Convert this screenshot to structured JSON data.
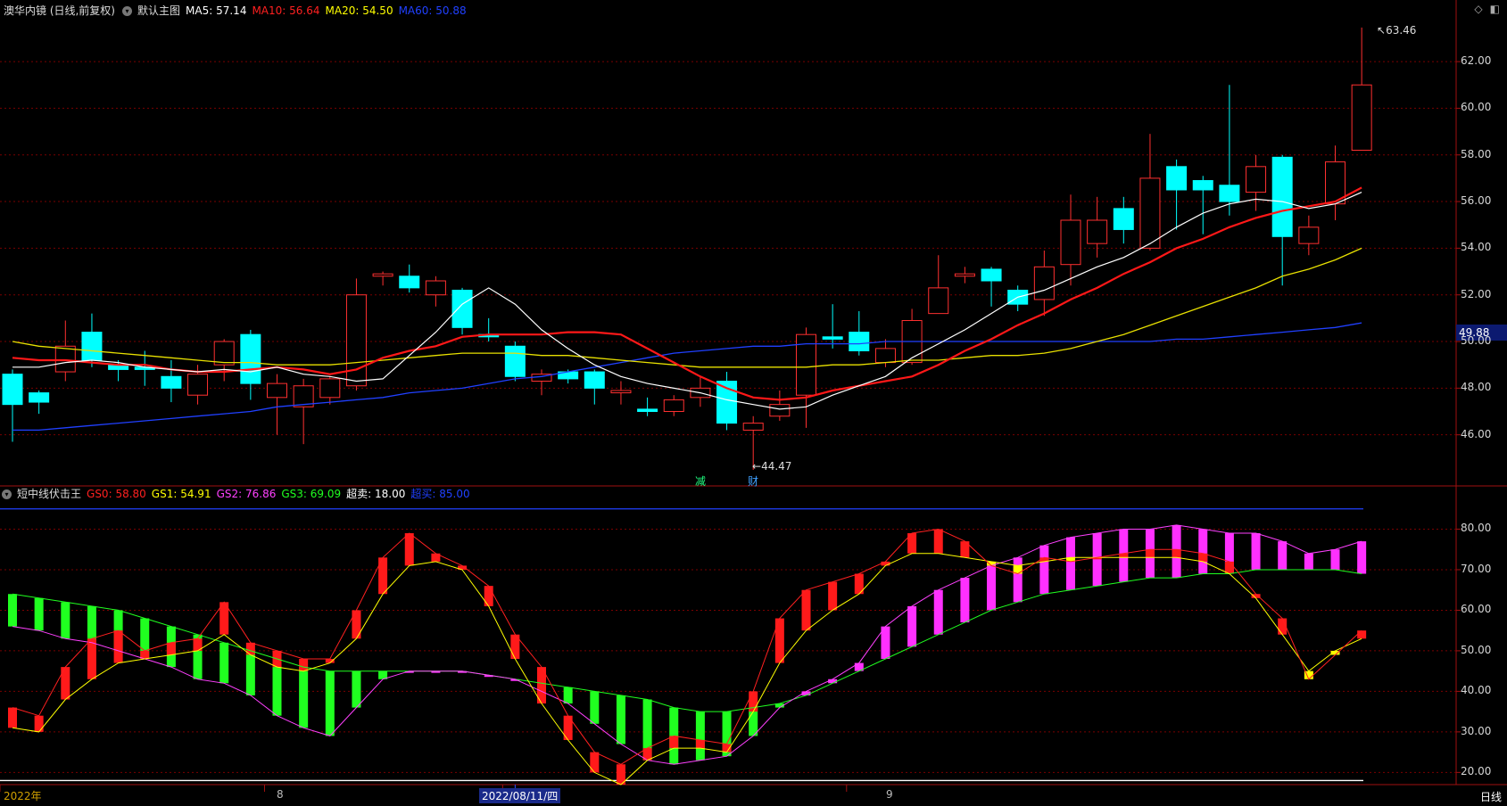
{
  "main": {
    "name": "澳华内镜 (日线,前复权)",
    "template": "默认主图",
    "ma": [
      {
        "label": "MA5:",
        "value": "57.14",
        "color": "#ffffff"
      },
      {
        "label": "MA10:",
        "value": "56.64",
        "color": "#ff2020"
      },
      {
        "label": "MA20:",
        "value": "54.50",
        "color": "#ffff00"
      },
      {
        "label": "MA60:",
        "value": "50.88",
        "color": "#2040ff"
      }
    ],
    "high_label": "63.46",
    "low_label": "44.47",
    "current_price_box": "49.88",
    "event_marks": [
      "减",
      "财"
    ],
    "ylim": [
      44,
      63.8
    ],
    "yticks": [
      "62.00",
      "60.00",
      "58.00",
      "56.00",
      "54.00",
      "52.00",
      "50.00",
      "48.00",
      "46.00"
    ]
  },
  "sub": {
    "name": "短中线伏击王",
    "indicators": [
      {
        "label": "GS0:",
        "value": "58.80",
        "color": "#ff2020"
      },
      {
        "label": "GS1:",
        "value": "54.91",
        "color": "#ffff00"
      },
      {
        "label": "GS2:",
        "value": "76.86",
        "color": "#ff40ff"
      },
      {
        "label": "GS3:",
        "value": "69.09",
        "color": "#20ff20"
      },
      {
        "label": "超卖:",
        "value": "18.00",
        "color": "#ffffff"
      },
      {
        "label": "超买:",
        "value": "85.00",
        "color": "#2040ff"
      }
    ],
    "ylim": [
      17,
      90
    ],
    "yticks": [
      "80.00",
      "70.00",
      "60.00",
      "50.00",
      "40.00",
      "30.00",
      "20.00"
    ]
  },
  "xaxis": {
    "labels": [
      "2022年",
      "8",
      "2022/08/11/四",
      "9"
    ],
    "period": "日线"
  },
  "chart_data": [
    {
      "type": "candlestick",
      "title": "澳华内镜 (日线,前复权)",
      "candles": [
        [
          48.6,
          47.3,
          45.7,
          48.8
        ],
        [
          47.8,
          47.4,
          46.9,
          47.9
        ],
        [
          48.7,
          49.8,
          48.3,
          50.9
        ],
        [
          50.4,
          49.2,
          48.9,
          51.2
        ],
        [
          49.0,
          48.8,
          48.3,
          49.2
        ],
        [
          48.9,
          48.8,
          48.1,
          49.6
        ],
        [
          48.5,
          48.0,
          47.4,
          49.2
        ],
        [
          47.7,
          48.6,
          47.3,
          49.0
        ],
        [
          49.0,
          50.0,
          48.3,
          50.1
        ],
        [
          50.3,
          48.2,
          47.5,
          50.5
        ],
        [
          47.6,
          48.2,
          46.0,
          48.6
        ],
        [
          47.2,
          48.1,
          45.6,
          48.4
        ],
        [
          47.6,
          48.4,
          47.3,
          48.5
        ],
        [
          48.1,
          52.0,
          47.9,
          52.7
        ],
        [
          52.8,
          52.9,
          52.4,
          53.0
        ],
        [
          52.8,
          52.3,
          52.1,
          53.3
        ],
        [
          52.0,
          52.6,
          51.5,
          52.8
        ],
        [
          52.2,
          50.6,
          50.3,
          52.3
        ],
        [
          50.3,
          50.2,
          50.0,
          51.0
        ],
        [
          49.8,
          48.5,
          48.3,
          50.0
        ],
        [
          48.3,
          48.6,
          47.7,
          48.8
        ],
        [
          48.7,
          48.4,
          48.2,
          48.8
        ],
        [
          48.7,
          48.0,
          47.3,
          48.8
        ],
        [
          47.8,
          47.9,
          47.3,
          48.3
        ],
        [
          47.1,
          47.0,
          46.8,
          47.6
        ],
        [
          47.0,
          47.5,
          46.8,
          47.7
        ],
        [
          47.6,
          48.0,
          47.2,
          48.5
        ],
        [
          48.3,
          46.5,
          46.2,
          48.7
        ],
        [
          46.2,
          46.5,
          44.5,
          46.8
        ],
        [
          46.8,
          47.3,
          46.6,
          47.9
        ],
        [
          47.7,
          50.3,
          46.3,
          50.6
        ],
        [
          50.2,
          50.1,
          49.7,
          51.6
        ],
        [
          50.4,
          49.6,
          49.4,
          51.3
        ],
        [
          49.1,
          49.7,
          48.9,
          50.1
        ],
        [
          49.1,
          50.9,
          49.0,
          51.4
        ],
        [
          51.2,
          52.3,
          51.2,
          53.7
        ],
        [
          52.8,
          52.9,
          52.5,
          53.2
        ],
        [
          53.1,
          52.6,
          51.5,
          53.2
        ],
        [
          52.2,
          51.6,
          51.3,
          52.4
        ],
        [
          51.8,
          53.2,
          51.1,
          53.9
        ],
        [
          53.3,
          55.2,
          52.4,
          56.3
        ],
        [
          54.2,
          55.2,
          53.6,
          56.2
        ],
        [
          55.7,
          54.8,
          54.2,
          56.2
        ],
        [
          54.0,
          57.0,
          53.9,
          58.9
        ],
        [
          57.5,
          56.5,
          54.8,
          57.8
        ],
        [
          56.9,
          56.5,
          54.6,
          57.1
        ],
        [
          56.7,
          56.0,
          55.4,
          61.0
        ],
        [
          56.4,
          57.5,
          55.6,
          58.0
        ],
        [
          57.9,
          54.5,
          52.4,
          58.0
        ],
        [
          54.2,
          54.9,
          53.7,
          55.4
        ],
        [
          55.9,
          57.7,
          55.2,
          58.4
        ],
        [
          58.2,
          61.0,
          58.2,
          63.46
        ]
      ],
      "ma5": [
        48.9,
        48.9,
        49.1,
        49.2,
        49.1,
        48.9,
        48.8,
        48.7,
        48.8,
        48.7,
        48.9,
        48.6,
        48.5,
        48.3,
        48.4,
        49.4,
        50.4,
        51.6,
        52.3,
        51.6,
        50.5,
        49.7,
        49.0,
        48.5,
        48.2,
        48.0,
        47.8,
        47.5,
        47.3,
        47.1,
        47.2,
        47.7,
        48.1,
        48.5,
        49.3,
        49.9,
        50.5,
        51.2,
        51.9,
        52.2,
        52.7,
        53.2,
        53.6,
        54.2,
        54.9,
        55.5,
        55.9,
        56.1,
        56.0,
        55.7,
        55.9,
        56.4
      ],
      "ma10": [
        49.3,
        49.2,
        49.2,
        49.1,
        49.0,
        49.0,
        48.8,
        48.7,
        48.7,
        48.8,
        48.9,
        48.8,
        48.6,
        48.8,
        49.3,
        49.6,
        49.8,
        50.2,
        50.3,
        50.3,
        50.3,
        50.4,
        50.4,
        50.3,
        49.7,
        49.1,
        48.5,
        48.0,
        47.6,
        47.5,
        47.6,
        47.9,
        48.1,
        48.3,
        48.5,
        49.0,
        49.6,
        50.1,
        50.7,
        51.2,
        51.8,
        52.3,
        52.9,
        53.4,
        54.0,
        54.4,
        54.9,
        55.3,
        55.6,
        55.8,
        56.0,
        56.6
      ],
      "ma20": [
        50.0,
        49.8,
        49.7,
        49.6,
        49.5,
        49.4,
        49.3,
        49.2,
        49.1,
        49.1,
        49.0,
        49.0,
        49.0,
        49.1,
        49.2,
        49.3,
        49.4,
        49.5,
        49.5,
        49.5,
        49.4,
        49.4,
        49.3,
        49.2,
        49.1,
        49.0,
        48.9,
        48.9,
        48.9,
        48.9,
        48.9,
        49.0,
        49.0,
        49.1,
        49.2,
        49.2,
        49.3,
        49.4,
        49.4,
        49.5,
        49.7,
        50.0,
        50.3,
        50.7,
        51.1,
        51.5,
        51.9,
        52.3,
        52.8,
        53.1,
        53.5,
        54.0
      ],
      "ma60": [
        46.2,
        46.2,
        46.3,
        46.4,
        46.5,
        46.6,
        46.7,
        46.8,
        46.9,
        47.0,
        47.2,
        47.3,
        47.4,
        47.5,
        47.6,
        47.8,
        47.9,
        48.0,
        48.2,
        48.4,
        48.5,
        48.7,
        48.9,
        49.1,
        49.3,
        49.5,
        49.6,
        49.7,
        49.8,
        49.8,
        49.9,
        49.9,
        49.9,
        50.0,
        50.0,
        50.0,
        50.0,
        50.0,
        50.0,
        50.0,
        50.0,
        50.0,
        50.0,
        50.0,
        50.1,
        50.1,
        50.2,
        50.3,
        50.4,
        50.5,
        50.6,
        50.8
      ]
    },
    {
      "type": "bar",
      "title": "短中线伏击王",
      "gs0": [
        36,
        34,
        46,
        53,
        55,
        50,
        52,
        53,
        62,
        52,
        50,
        48,
        48,
        60,
        73,
        79,
        74,
        71,
        66,
        54,
        46,
        34,
        25,
        22,
        26,
        29,
        28,
        27,
        40,
        58,
        65,
        67,
        69,
        72,
        79,
        80,
        77,
        71,
        69,
        73,
        72,
        73,
        74,
        75,
        75,
        74,
        72,
        64,
        58,
        43,
        49,
        55
      ],
      "gs1": [
        31,
        30,
        38,
        43,
        47,
        48,
        49,
        50,
        54,
        49,
        46,
        45,
        47,
        53,
        64,
        71,
        72,
        70,
        61,
        48,
        37,
        28,
        20,
        17,
        23,
        26,
        26,
        25,
        35,
        47,
        55,
        60,
        64,
        71,
        74,
        74,
        73,
        72,
        71,
        72,
        73,
        73,
        73,
        73,
        73,
        72,
        69,
        63,
        54,
        45,
        50,
        53
      ],
      "gs2": [
        56,
        55,
        53,
        52,
        50,
        48,
        46,
        43,
        42,
        39,
        34,
        31,
        29,
        36,
        43,
        45,
        45,
        45,
        44,
        43,
        40,
        37,
        32,
        27,
        23,
        22,
        23,
        24,
        29,
        36,
        40,
        43,
        47,
        56,
        61,
        65,
        68,
        71,
        73,
        76,
        78,
        79,
        80,
        80,
        81,
        80,
        79,
        79,
        77,
        74,
        75,
        77
      ],
      "gs3": [
        64,
        63,
        62,
        61,
        60,
        58,
        56,
        54,
        52,
        50,
        48,
        46,
        45,
        45,
        45,
        45,
        45,
        45,
        44,
        43,
        42,
        41,
        40,
        39,
        38,
        36,
        35,
        35,
        36,
        37,
        39,
        42,
        45,
        48,
        51,
        54,
        57,
        60,
        62,
        64,
        65,
        66,
        67,
        68,
        68,
        69,
        69,
        70,
        70,
        70,
        70,
        69
      ],
      "oversold": 18,
      "overbought": 85
    }
  ]
}
